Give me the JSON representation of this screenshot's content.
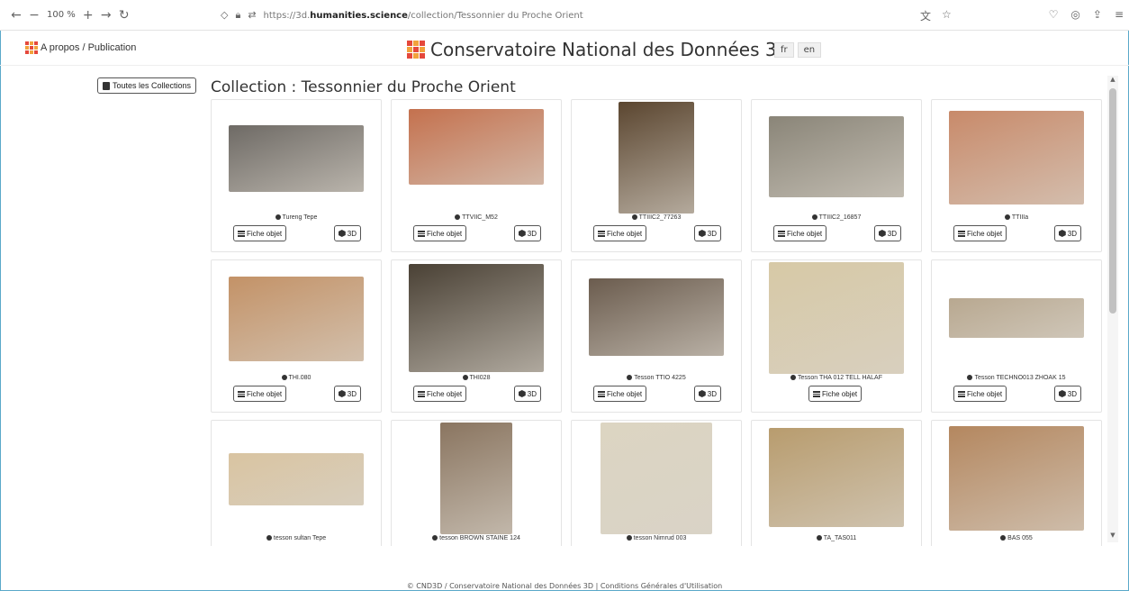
{
  "browser": {
    "zoom": "100 %",
    "url_prefix": "https://3d.",
    "url_host": "humanities.science",
    "url_path": "/collection/Tessonnier du Proche Orient"
  },
  "header": {
    "apropos_label": "A propos / Publication",
    "site_title": "Conservatoire National des Données 3D",
    "lang_fr": "fr",
    "lang_en": "en"
  },
  "sidebar": {
    "toutes_label": "Toutes les Collections"
  },
  "page": {
    "heading": "Collection : Tessonnier du Proche Orient"
  },
  "buttons": {
    "fiche": "Fiche objet",
    "d3": "3D"
  },
  "cards": [
    {
      "name": "Tureng Tepe",
      "has3d": true,
      "color": "#6e6a65"
    },
    {
      "name": "TTVIIC_M52",
      "has3d": true,
      "color": "#c4714e"
    },
    {
      "name": "TTIIIC2_77263",
      "has3d": true,
      "color": "#5b4630"
    },
    {
      "name": "TTIIIC2_16857",
      "has3d": true,
      "color": "#8a8578"
    },
    {
      "name": "TTIIIa",
      "has3d": true,
      "color": "#c88a6a"
    },
    {
      "name": "THI.080",
      "has3d": true,
      "color": "#c39267"
    },
    {
      "name": "THI028",
      "has3d": true,
      "color": "#4a4135"
    },
    {
      "name": "Tesson TTIO 4225",
      "has3d": true,
      "color": "#6b5c4e"
    },
    {
      "name": "Tesson THA 012 TELL HALAF",
      "has3d": false,
      "color": "#d7c9a6"
    },
    {
      "name": "Tesson TECHNO013 ZHOAK 15",
      "has3d": true,
      "color": "#b8a890"
    },
    {
      "name": "tesson sultan Tepe",
      "has3d": true,
      "color": "#d9c4a1"
    },
    {
      "name": "tesson BROWN STAINE 124",
      "has3d": true,
      "color": "#8a7560"
    },
    {
      "name": "tesson Nimrud 003",
      "has3d": true,
      "color": "#dcd5c2"
    },
    {
      "name": "TA_TAS011",
      "has3d": true,
      "color": "#b89c6e"
    },
    {
      "name": "BAS 055",
      "has3d": true,
      "color": "#b4875f"
    }
  ],
  "footer": {
    "text": "© CND3D / Conservatoire National des Données 3D | Conditions Générales d'Utilisation"
  }
}
